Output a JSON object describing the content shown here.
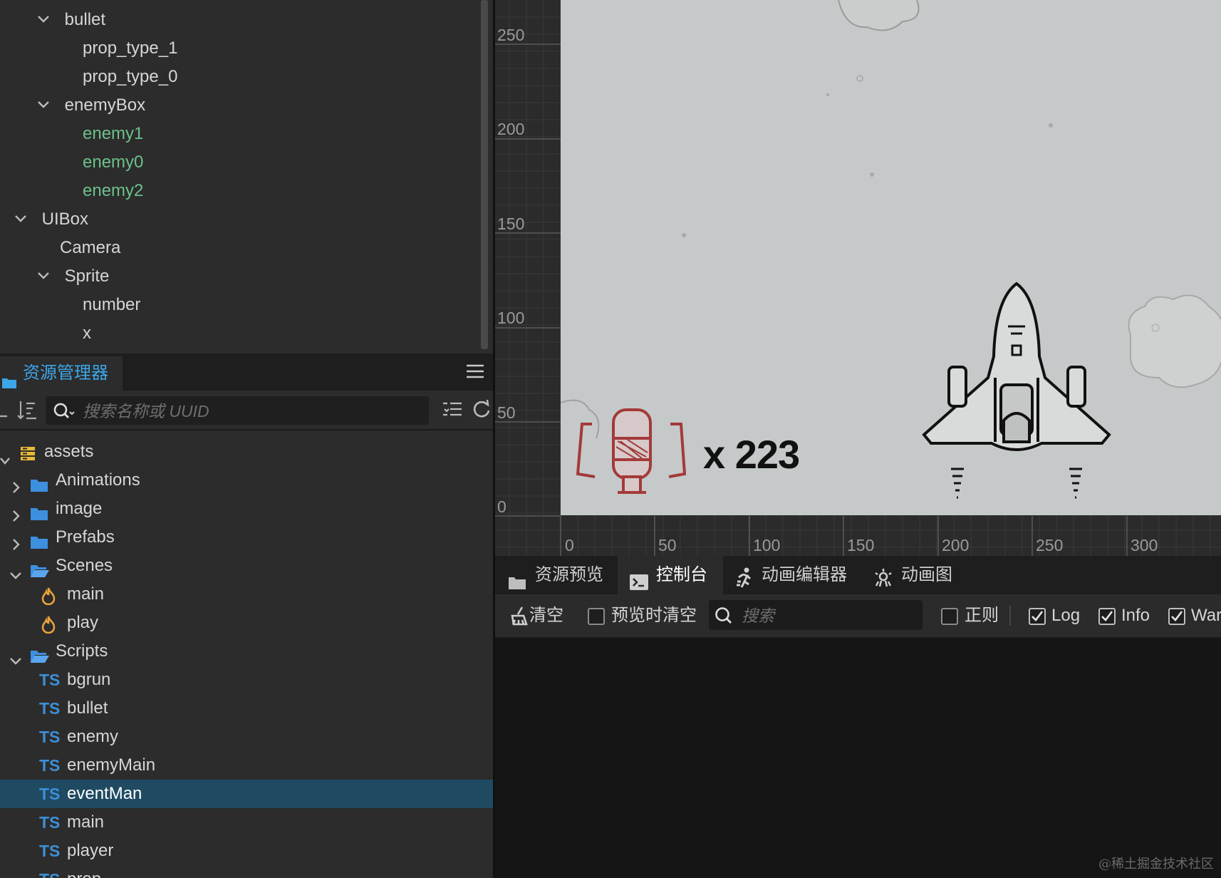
{
  "hierarchy": {
    "nodes": [
      {
        "label": "bullet"
      },
      {
        "label": "prop_type_1"
      },
      {
        "label": "prop_type_0"
      },
      {
        "label": "enemyBox"
      },
      {
        "label": "enemy1"
      },
      {
        "label": "enemy0"
      },
      {
        "label": "enemy2"
      },
      {
        "label": "UIBox"
      },
      {
        "label": "Camera"
      },
      {
        "label": "Sprite"
      },
      {
        "label": "number"
      },
      {
        "label": "x"
      }
    ]
  },
  "assets_panel": {
    "tab_label": "资源管理器",
    "search_placeholder": "搜索名称或 UUID",
    "items": [
      {
        "label": "assets"
      },
      {
        "label": "Animations"
      },
      {
        "label": "image"
      },
      {
        "label": "Prefabs"
      },
      {
        "label": "Scenes"
      },
      {
        "label": "main"
      },
      {
        "label": "play"
      },
      {
        "label": "Scripts"
      },
      {
        "label": "bgrun"
      },
      {
        "label": "bullet"
      },
      {
        "label": "enemy"
      },
      {
        "label": "enemyMain"
      },
      {
        "label": "eventMan"
      },
      {
        "label": "main"
      },
      {
        "label": "player"
      },
      {
        "label": "prop"
      }
    ],
    "ts_badge": "TS"
  },
  "scene": {
    "y_ticks": [
      "250",
      "200",
      "150",
      "100",
      "50",
      "0"
    ],
    "x_ticks": [
      "0",
      "50",
      "100",
      "150",
      "200",
      "250",
      "300"
    ],
    "bomb_count_label": "x 223"
  },
  "console": {
    "tabs": [
      {
        "label": "资源预览"
      },
      {
        "label": "控制台"
      },
      {
        "label": "动画编辑器"
      },
      {
        "label": "动画图"
      }
    ],
    "toolbar": {
      "clear_label": "清空",
      "clear_on_preview_label": "预览时清空",
      "search_placeholder": "搜索",
      "regex_label": "正则",
      "log_label": "Log",
      "info_label": "Info",
      "warn_label": "War"
    }
  },
  "watermark": "@稀土掘金技术社区",
  "colors": {
    "selected_row": "#1f4a62",
    "prefab_green": "#6cc08a",
    "accent_blue": "#3da6e8",
    "ts_blue": "#3c8fd6",
    "folder_blue": "#3d8fe0",
    "scene_orange": "#e8a23a"
  }
}
